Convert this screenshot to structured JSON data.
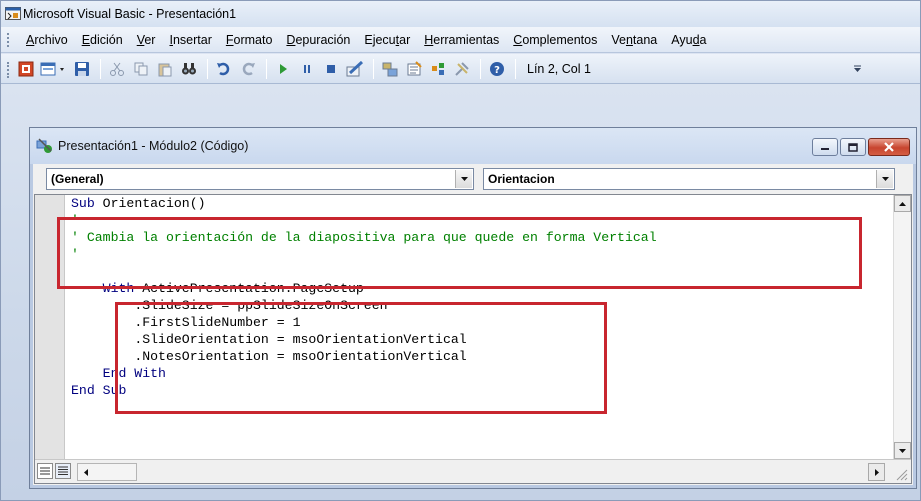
{
  "app": {
    "title": "Microsoft Visual Basic - Presentación1"
  },
  "menu": [
    {
      "label": "Archivo",
      "ul": 0
    },
    {
      "label": "Edición",
      "ul": 0
    },
    {
      "label": "Ver",
      "ul": 0
    },
    {
      "label": "Insertar",
      "ul": 0
    },
    {
      "label": "Formato",
      "ul": 0
    },
    {
      "label": "Depuración",
      "ul": 0
    },
    {
      "label": "Ejecutar",
      "ul": 5
    },
    {
      "label": "Herramientas",
      "ul": 0
    },
    {
      "label": "Complementos",
      "ul": 0
    },
    {
      "label": "Ventana",
      "ul": 2
    },
    {
      "label": "Ayuda",
      "ul": 3
    }
  ],
  "toolbar": {
    "status": "Lín 2, Col 1",
    "overflow_icon": "chevron-down-icon"
  },
  "code_window": {
    "title": "Presentación1 - Módulo2 (Código)",
    "object_dropdown": "(General)",
    "procedure_dropdown": "Orientacion"
  },
  "code": [
    {
      "indent": "",
      "parts": [
        {
          "t": "Sub",
          "k": "kw"
        },
        {
          "t": " Orientacion()",
          "k": "tx"
        }
      ]
    },
    {
      "indent": "",
      "parts": [
        {
          "t": "'",
          "k": "cm"
        }
      ]
    },
    {
      "indent": "",
      "parts": [
        {
          "t": "' Cambia la orientación de la diapositiva para que quede en forma Vertical",
          "k": "cm"
        }
      ]
    },
    {
      "indent": "",
      "parts": [
        {
          "t": "'",
          "k": "cm"
        }
      ]
    },
    {
      "indent": "",
      "parts": []
    },
    {
      "indent": "    ",
      "parts": [
        {
          "t": "With",
          "k": "kw"
        },
        {
          "t": " ActivePresentation.PageSetup",
          "k": "tx"
        }
      ]
    },
    {
      "indent": "        ",
      "parts": [
        {
          "t": ".SlideSize = ppSlideSizeOnScreen",
          "k": "tx"
        }
      ]
    },
    {
      "indent": "        ",
      "parts": [
        {
          "t": ".FirstSlideNumber = 1",
          "k": "tx"
        }
      ]
    },
    {
      "indent": "        ",
      "parts": [
        {
          "t": ".SlideOrientation = msoOrientationVertical",
          "k": "tx"
        }
      ]
    },
    {
      "indent": "        ",
      "parts": [
        {
          "t": ".NotesOrientation = msoOrientationVertical",
          "k": "tx"
        }
      ]
    },
    {
      "indent": "    ",
      "parts": [
        {
          "t": "End With",
          "k": "kw"
        }
      ]
    },
    {
      "indent": "",
      "parts": [
        {
          "t": "End Sub",
          "k": "kw"
        }
      ]
    }
  ],
  "colors": {
    "keyword": "#00007f",
    "comment": "#008000",
    "highlight_box": "#c8262f"
  }
}
